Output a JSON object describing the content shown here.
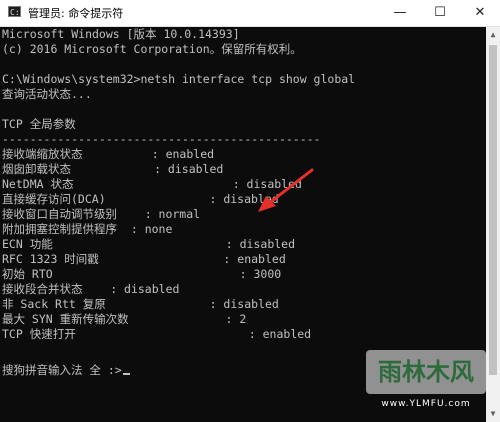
{
  "window": {
    "title": "管理员: 命令提示符",
    "icon": "cmd-icon",
    "min_glyph": "—",
    "max_glyph": "☐",
    "close_glyph": "✕"
  },
  "console": {
    "lines": [
      "Microsoft Windows [版本 10.0.14393]",
      "(c) 2016 Microsoft Corporation。保留所有权利。",
      "",
      "C:\\Windows\\system32>netsh interface tcp show global",
      "查询活动状态...",
      "",
      "TCP 全局参数",
      "----------------------------------------------",
      "接收端缩放状态          : enabled",
      "烟囱卸载状态            : disabled",
      "NetDMA 状态                       : disabled",
      "直接缓存访问(DCA)               : disabled",
      "接收窗口自动调节级别    : normal",
      "附加拥塞控制提供程序  : none",
      "ECN 功能                         : disabled",
      "RFC 1323 时间戳                  : enabled",
      "初始 RTO                           : 3000",
      "接收段合并状态    : disabled",
      "非 Sack Rtt 复原               : disabled",
      "最大 SYN 重新传输次数              : 2",
      "TCP 快速打开                         : enabled",
      "",
      "",
      "搜狗拼音输入法 全 :>"
    ]
  },
  "watermark": {
    "brand": "雨林木风",
    "url": "www.YLMFU.com"
  },
  "annotation": {
    "arrow_color": "#e8302a"
  },
  "colors": {
    "console_bg": "#0c0c0c",
    "console_text": "#c0c0c0"
  }
}
